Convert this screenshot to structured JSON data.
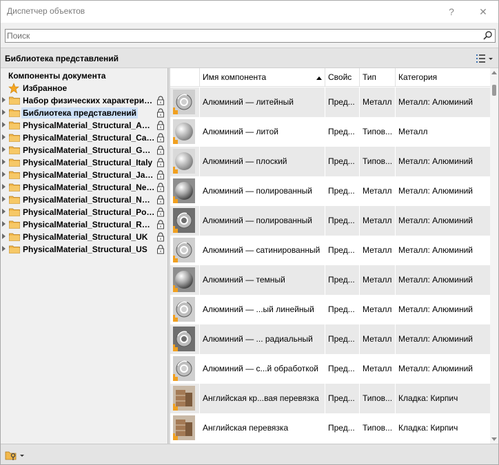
{
  "window": {
    "title": "Диспетчер объектов"
  },
  "titlebar": {
    "help_label": "?",
    "close_label": "✕"
  },
  "search": {
    "placeholder": "Поиск",
    "value": ""
  },
  "library_bar": {
    "title": "Библиотека представлений"
  },
  "tree": {
    "header": "Компоненты документа",
    "favorites": "Избранное",
    "items": [
      {
        "label": "Набор физических характеристик",
        "locked": true
      },
      {
        "label": "Библиотека представлений",
        "locked": true,
        "selected": true
      },
      {
        "label": "PhysicalMaterial_Structural_Australia",
        "locked": true
      },
      {
        "label": "PhysicalMaterial_Structural_Canada",
        "locked": true
      },
      {
        "label": "PhysicalMaterial_Structural_Germany",
        "locked": true
      },
      {
        "label": "PhysicalMaterial_Structural_Italy",
        "locked": true
      },
      {
        "label": "PhysicalMaterial_Structural_Japan",
        "locked": true
      },
      {
        "label": "PhysicalMaterial_Structural_Netherlands",
        "locked": true
      },
      {
        "label": "PhysicalMaterial_Structural_Norway",
        "locked": true
      },
      {
        "label": "PhysicalMaterial_Structural_Poland",
        "locked": true
      },
      {
        "label": "PhysicalMaterial_Structural_Russia",
        "locked": true
      },
      {
        "label": "PhysicalMaterial_Structural_UK",
        "locked": true
      },
      {
        "label": "PhysicalMaterial_Structural_US",
        "locked": true
      }
    ]
  },
  "grid": {
    "columns": [
      "Имя компонента",
      "Свойс",
      "Тип",
      "Категория"
    ],
    "rows": [
      {
        "name": "Алюминий — литейный",
        "prop": "Пред...",
        "type": "Металл",
        "category": "Металл: Алюминий",
        "thumb": "torus"
      },
      {
        "name": "Алюминий — литой",
        "prop": "Пред...",
        "type": "Типов...",
        "category": "Металл",
        "thumb": "sphere"
      },
      {
        "name": "Алюминий — плоский",
        "prop": "Пред...",
        "type": "Типов...",
        "category": "Металл: Алюминий",
        "thumb": "sphere"
      },
      {
        "name": "Алюминий — полированный",
        "prop": "Пред...",
        "type": "Металл",
        "category": "Металл: Алюминий",
        "thumb": "sphere-shiny"
      },
      {
        "name": "Алюминий — полированный",
        "prop": "Пред...",
        "type": "Металл",
        "category": "Металл: Алюминий",
        "thumb": "torus-dark"
      },
      {
        "name": "Алюминий — сатинированный",
        "prop": "Пред...",
        "type": "Металл",
        "category": "Металл: Алюминий",
        "thumb": "torus"
      },
      {
        "name": "Алюминий — темный",
        "prop": "Пред...",
        "type": "Металл",
        "category": "Металл: Алюминий",
        "thumb": "sphere-shiny"
      },
      {
        "name": "Алюминий — ...ый линейный",
        "prop": "Пред...",
        "type": "Металл",
        "category": "Металл: Алюминий",
        "thumb": "torus"
      },
      {
        "name": "Алюминий — ... радиальный",
        "prop": "Пред...",
        "type": "Металл",
        "category": "Металл: Алюминий",
        "thumb": "torus-dark"
      },
      {
        "name": "Алюминий — с...й обработкой",
        "prop": "Пред...",
        "type": "Металл",
        "category": "Металл: Алюминий",
        "thumb": "torus"
      },
      {
        "name": "Английская кр...вая перевязка",
        "prop": "Пред...",
        "type": "Типов...",
        "category": "Кладка: Кирпич",
        "thumb": "brick"
      },
      {
        "name": "Английская перевязка",
        "prop": "Пред...",
        "type": "Типов...",
        "category": "Кладка: Кирпич",
        "thumb": "brick"
      }
    ]
  },
  "icons": {
    "search": "search-icon",
    "favorites": "star-icon",
    "folder": "folder-icon",
    "lock": "lock-icon",
    "view_options": "list-view-icon",
    "footer": "folder-key-icon"
  },
  "colors": {
    "selection": "#cde0f7",
    "alt_row": "#e9e9e9",
    "folder": "#f2b84b",
    "star": "#f5a623"
  }
}
